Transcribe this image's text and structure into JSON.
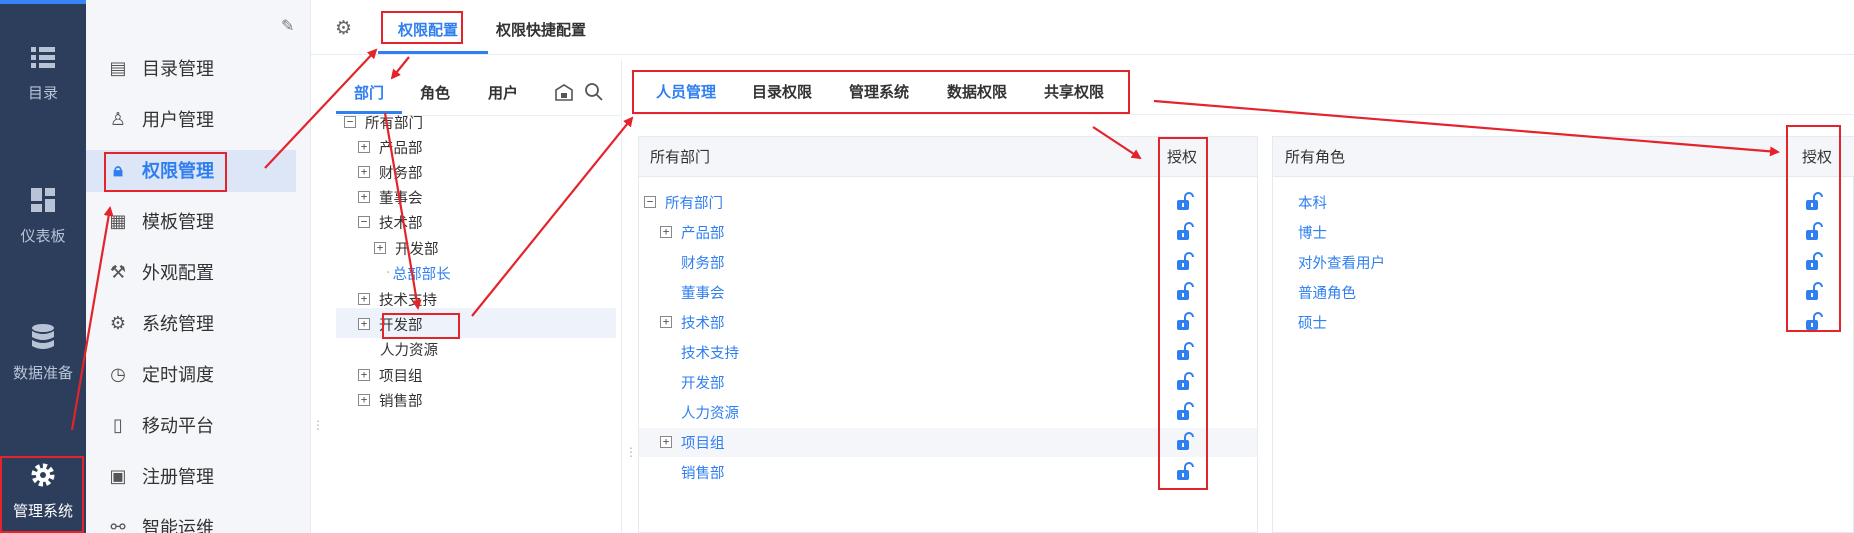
{
  "rail": {
    "items": [
      {
        "label": "目录",
        "icon": "list-icon"
      },
      {
        "label": "仪表板",
        "icon": "dashboard-icon"
      },
      {
        "label": "数据准备",
        "icon": "database-icon"
      },
      {
        "label": "管理系统",
        "icon": "gear-icon"
      }
    ]
  },
  "menu": {
    "items": [
      {
        "label": "目录管理",
        "icon": "catalog-icon"
      },
      {
        "label": "用户管理",
        "icon": "user-icon"
      },
      {
        "label": "权限管理",
        "icon": "lock-icon"
      },
      {
        "label": "模板管理",
        "icon": "template-icon"
      },
      {
        "label": "外观配置",
        "icon": "brush-icon"
      },
      {
        "label": "系统管理",
        "icon": "gear-icon"
      },
      {
        "label": "定时调度",
        "icon": "timer-icon"
      },
      {
        "label": "移动平台",
        "icon": "mobile-icon"
      },
      {
        "label": "注册管理",
        "icon": "register-icon"
      },
      {
        "label": "智能运维",
        "icon": "network-icon"
      }
    ]
  },
  "top_tabs": [
    "权限配置",
    "权限快捷配置"
  ],
  "panel_tabs": [
    "部门",
    "角色",
    "用户"
  ],
  "tree": [
    {
      "label": "所有部门",
      "toggle": "−"
    },
    {
      "label": "产品部",
      "toggle": "+"
    },
    {
      "label": "财务部",
      "toggle": "+"
    },
    {
      "label": "董事会",
      "toggle": "+"
    },
    {
      "label": "技术部",
      "toggle": "−"
    },
    {
      "label": "开发部",
      "toggle": "+"
    },
    {
      "label": "总部部长",
      "toggle": ""
    },
    {
      "label": "技术支持",
      "toggle": "+"
    },
    {
      "label": "开发部",
      "toggle": "+"
    },
    {
      "label": "人力资源",
      "toggle": ""
    },
    {
      "label": "项目组",
      "toggle": "+"
    },
    {
      "label": "销售部",
      "toggle": "+"
    }
  ],
  "sub_tabs": [
    "人员管理",
    "目录权限",
    "管理系统",
    "数据权限",
    "共享权限"
  ],
  "dept_panel": {
    "header": "所有部门",
    "auth_label": "授权",
    "rows": [
      {
        "label": "所有部门",
        "toggle": "−"
      },
      {
        "label": "产品部",
        "toggle": "+"
      },
      {
        "label": "财务部",
        "toggle": ""
      },
      {
        "label": "董事会",
        "toggle": ""
      },
      {
        "label": "技术部",
        "toggle": "+"
      },
      {
        "label": "技术支持",
        "toggle": ""
      },
      {
        "label": "开发部",
        "toggle": ""
      },
      {
        "label": "人力资源",
        "toggle": ""
      },
      {
        "label": "项目组",
        "toggle": "+"
      },
      {
        "label": "销售部",
        "toggle": ""
      }
    ]
  },
  "role_panel": {
    "header": "所有角色",
    "auth_label": "授权",
    "rows": [
      "本科",
      "博士",
      "对外查看用户",
      "普通角色",
      "硕士"
    ]
  },
  "colors": {
    "accent": "#2f7ff0",
    "rail": "#2c3e5c",
    "annotation": "#e3242b"
  }
}
